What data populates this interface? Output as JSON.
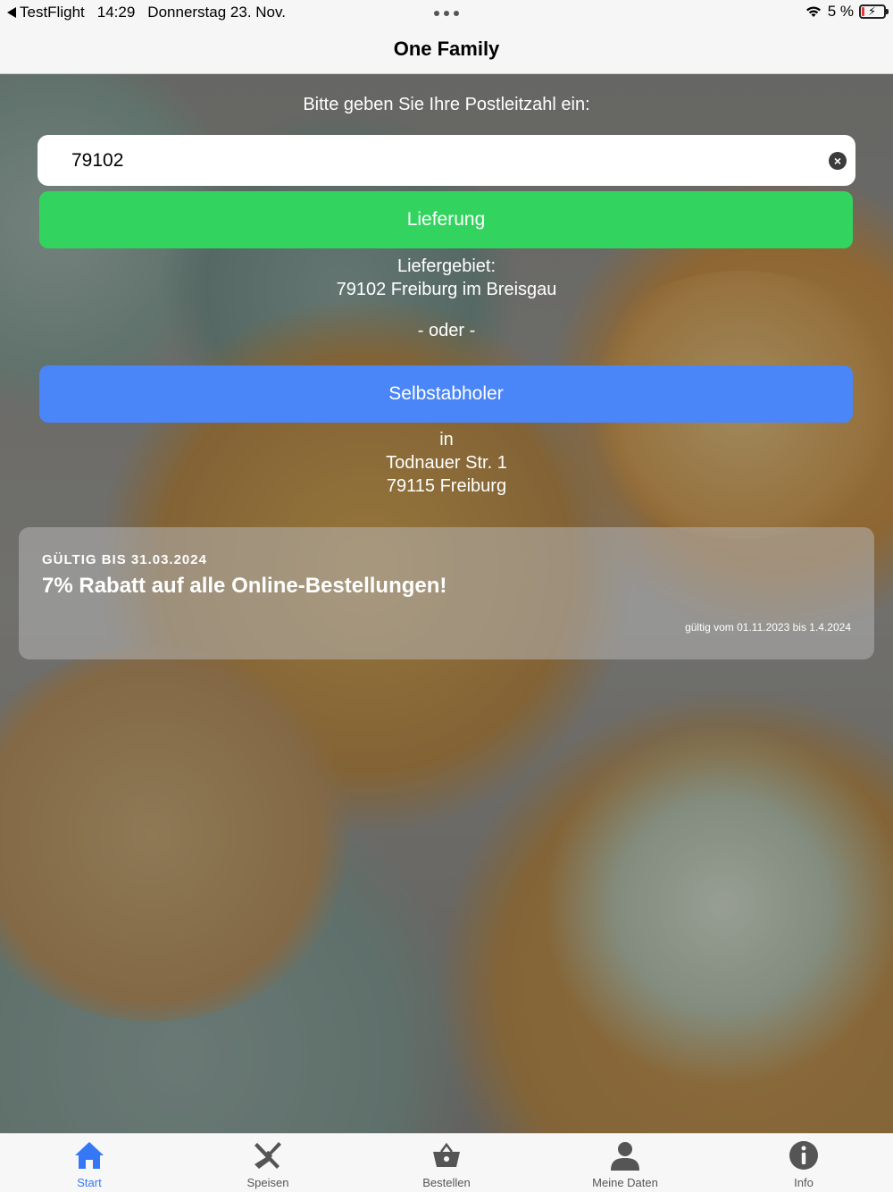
{
  "status_bar": {
    "back_app": "TestFlight",
    "time": "14:29",
    "date": "Donnerstag 23. Nov.",
    "battery": "5 %"
  },
  "nav": {
    "title": "One Family"
  },
  "zip": {
    "prompt": "Bitte geben Sie Ihre Postleitzahl ein:",
    "value": "79102"
  },
  "delivery": {
    "button_label": "Lieferung",
    "area_label": "Liefergebiet:",
    "area_value": "79102 Freiburg im Breisgau"
  },
  "or_label": "- oder -",
  "pickup": {
    "button_label": "Selbstabholer",
    "in_label": "in",
    "street": "Todnauer Str. 1",
    "city": "79115 Freiburg"
  },
  "promo": {
    "valid_until": "GÜLTIG BIS 31.03.2024",
    "title": "7% Rabatt auf alle Online-Bestellungen!",
    "note": "gültig vom 01.11.2023 bis 1.4.2024"
  },
  "tabs": [
    {
      "label": "Start",
      "icon": "house-icon",
      "active": true
    },
    {
      "label": "Speisen",
      "icon": "fork-knife-icon",
      "active": false
    },
    {
      "label": "Bestellen",
      "icon": "basket-icon",
      "active": false
    },
    {
      "label": "Meine Daten",
      "icon": "person-icon",
      "active": false
    },
    {
      "label": "Info",
      "icon": "info-icon",
      "active": false
    }
  ],
  "colors": {
    "accent_green": "#32d45f",
    "accent_blue": "#4a86f7",
    "tab_active": "#3478f6",
    "tab_inactive": "#555555"
  }
}
